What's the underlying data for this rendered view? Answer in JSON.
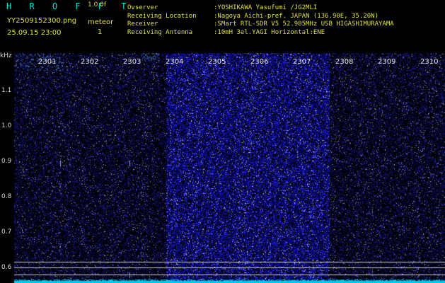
{
  "header": {
    "logo_text": "H R O F F T",
    "version": "1.0.0f",
    "filename": "YY2509152300.png",
    "meteor_label": "meteor",
    "meteor_count": "1",
    "datetime": "25.09.15 23:00",
    "info": [
      {
        "key": "Ovserver",
        "value": ":YOSHIKAWA Yasufumi /JG2MLI"
      },
      {
        "key": "Receiving Location",
        "value": ":Nagoya Aichi-pref. JAPAN (136.90E, 35.20N)"
      },
      {
        "key": "Receiver",
        "value": ":SMart RTL-SDR V5 52.905MHz USB HIGASHIMURAYAMA"
      },
      {
        "key": "Receiving Antenna",
        "value": ":10mH 3el.YAGI Horizontal:ENE"
      }
    ]
  },
  "plot": {
    "y_unit": "kHz",
    "y_ticks": [
      "1.1",
      "1.0",
      "0.9",
      "0.8",
      "0.7",
      "0.6"
    ],
    "x_ticks": [
      "2301",
      "2302",
      "2303",
      "2304",
      "2305",
      "2306",
      "2307",
      "2308",
      "2309",
      "2310"
    ],
    "colors": {
      "background": "#000000",
      "spectrum": "#1a1aa0",
      "trace": "#00e5ff",
      "text": "#e0e040"
    }
  }
}
